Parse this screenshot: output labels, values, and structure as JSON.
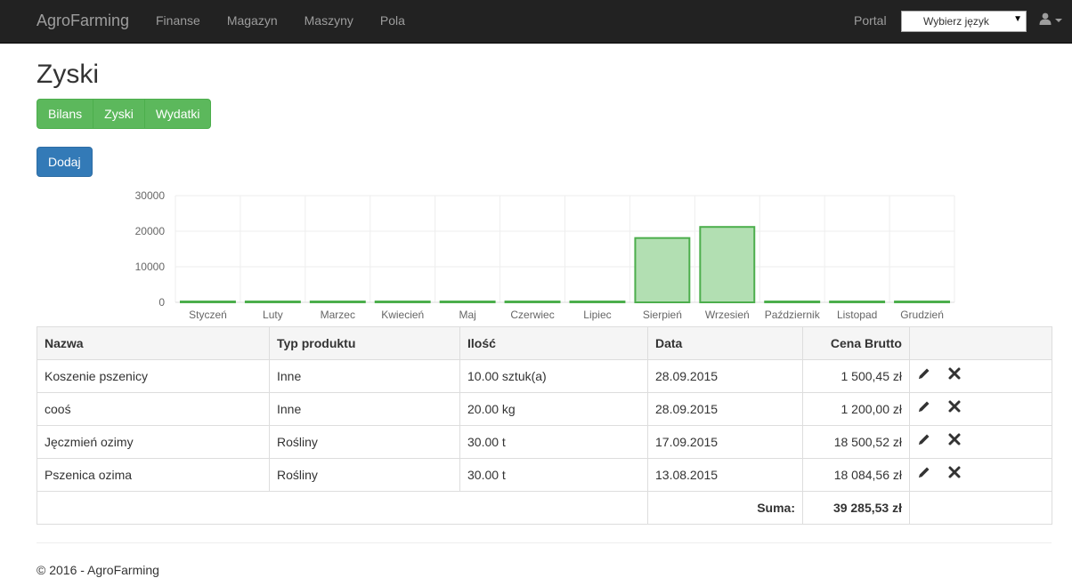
{
  "navbar": {
    "brand": "AgroFarming",
    "links": [
      "Finanse",
      "Magazyn",
      "Maszyny",
      "Pola"
    ],
    "portal": "Portal",
    "language_select": "Wybierz język",
    "user_icon": "user-icon"
  },
  "page": {
    "title": "Zyski",
    "tabs": [
      "Bilans",
      "Zyski",
      "Wydatki"
    ],
    "add_button": "Dodaj"
  },
  "chart_data": {
    "type": "bar",
    "categories": [
      "Styczeń",
      "Luty",
      "Marzec",
      "Kwiecień",
      "Maj",
      "Czerwiec",
      "Lipiec",
      "Sierpień",
      "Wrzesień",
      "Październik",
      "Listopad",
      "Grudzień"
    ],
    "values": [
      0,
      0,
      0,
      0,
      0,
      0,
      0,
      18084.56,
      21200.97,
      0,
      0,
      0
    ],
    "ylim": [
      0,
      30000
    ],
    "yticks": [
      0,
      10000,
      20000,
      30000
    ],
    "grid": true,
    "bar_fill": "#b2dfb2",
    "bar_stroke": "#4cae4c"
  },
  "table": {
    "headers": [
      "Nazwa",
      "Typ produktu",
      "Ilość",
      "Data",
      "Cena Brutto",
      ""
    ],
    "rows": [
      {
        "name": "Koszenie pszenicy",
        "type": "Inne",
        "quantity": "10.00 sztuk(a)",
        "date": "28.09.2015",
        "price": "1 500,45 zł"
      },
      {
        "name": "cooś",
        "type": "Inne",
        "quantity": "20.00 kg",
        "date": "28.09.2015",
        "price": "1 200,00 zł"
      },
      {
        "name": "Jęczmień ozimy",
        "type": "Rośliny",
        "quantity": "30.00 t",
        "date": "17.09.2015",
        "price": "18 500,52 zł"
      },
      {
        "name": "Pszenica ozima",
        "type": "Rośliny",
        "quantity": "30.00 t",
        "date": "13.08.2015",
        "price": "18 084,56 zł"
      }
    ],
    "sum_label": "Suma:",
    "sum_value": "39 285,53 zł",
    "edit_icon": "pencil-icon",
    "delete_icon": "close-icon"
  },
  "footer": {
    "text": "© 2016 - AgroFarming"
  }
}
